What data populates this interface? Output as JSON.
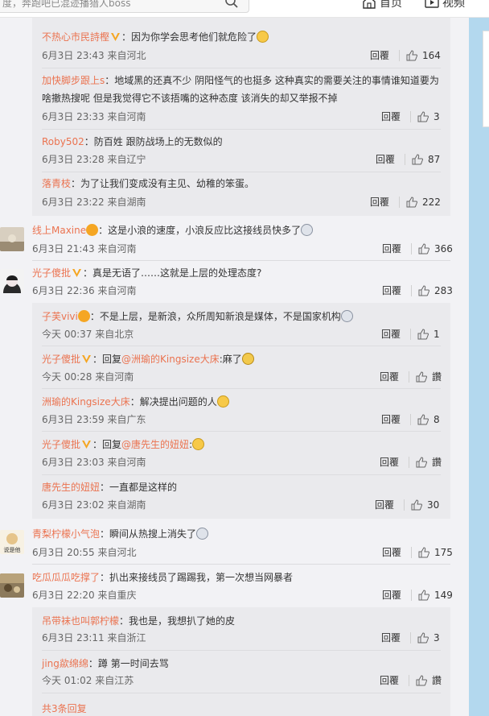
{
  "topbar": {
    "search_text": "度，奔跑吧已混迹播猎人boss",
    "nav_home": "首页",
    "nav_video": "视频"
  },
  "labels": {
    "reply": "回覆",
    "like_zan": "讚"
  },
  "comments": [
    {
      "name": "不热心市民詩樫",
      "badge": "gold-v",
      "text": "因为你学会思考他们就危险了",
      "emoji": "smile-emoji",
      "time": "6月3日 23:43",
      "loc": "来自河北",
      "likes": "164"
    },
    {
      "name": "加快脚步跟上s",
      "badge": "",
      "text": "地域黑的还真不少 阴阳怪气的也挺多 这种真实的需要关注的事情谁知道要为",
      "text2": "啥撤热搜呢 但是我觉得它不该捂嘴的这种态度 该消失的却又举报不掉",
      "time": "6月3日 23:33",
      "loc": "来自河南",
      "likes": "3"
    },
    {
      "name": "Roby502",
      "badge": "",
      "text": "防百姓 跟防战场上的无数似的",
      "time": "6月3日 23:28",
      "loc": "来自辽宁",
      "likes": "87"
    },
    {
      "name": "落青枝",
      "badge": "",
      "text": "为了让我们变成没有主见、幼稚的笨蛋。",
      "time": "6月3日 23:22",
      "loc": "来自湖南",
      "likes": "222"
    },
    {
      "name": "线上Maxine",
      "badge": "orange-crown",
      "text": "这是小浪的速度，小浪反应比这接线员快多了",
      "emoji": "cry-emoji",
      "time": "6月3日 21:43",
      "loc": "来自河南",
      "likes": "366"
    },
    {
      "name": "光子傻批",
      "badge": "gold-v",
      "text": "真是无语了……这就是上层的处理态度?",
      "time": "6月3日 22:36",
      "loc": "来自河南",
      "likes": "283"
    },
    {
      "name": "子芙vivi",
      "badge": "orange-crown",
      "text": "不是上层，是新浪，众所周知新浪是媒体，不是国家机构",
      "emoji": "cry-emoji",
      "time": "今天 00:37",
      "loc": "来自北京",
      "likes": "1"
    },
    {
      "name": "光子傻批",
      "badge": "gold-v",
      "prefix": "回复",
      "mention": "@洲瑜的Kingsize大床",
      "text": ":麻了",
      "emoji": "sweat-emoji",
      "time": "今天 00:28",
      "loc": "来自河南",
      "likes": "讚"
    },
    {
      "name": "洲瑜的Kingsize大床",
      "badge": "",
      "text": "解决提出问题的人",
      "emoji": "shock-emoji",
      "time": "6月3日 23:59",
      "loc": "来自广东",
      "likes": "8"
    },
    {
      "name": "光子傻批",
      "badge": "gold-v",
      "prefix": "回复",
      "mention": "@唐先生的妞妞",
      "text": ":",
      "emoji": "tear-emoji",
      "time": "6月3日 23:03",
      "loc": "来自河南",
      "likes": "讚"
    },
    {
      "name": "唐先生的妞妞",
      "badge": "",
      "text": "一直都是这样的",
      "time": "6月3日 23:02",
      "loc": "来自湖南",
      "likes": "30"
    },
    {
      "name": "青梨柠檬小气泡",
      "badge": "",
      "text": "瞬间从热搜上消失了",
      "emoji": "cry-emoji",
      "time": "6月3日 20:55",
      "loc": "来自河北",
      "likes": "175"
    },
    {
      "name": "吃瓜瓜瓜吃撑了",
      "badge": "",
      "text": "扒出来接线员了踢踢我，第一次想当网暴者",
      "time": "6月3日 22:20",
      "loc": "来自重庆",
      "likes": "149"
    },
    {
      "name": "吊带袜也叫郭柠檬",
      "badge": "",
      "text": "我也是，我想扒了她的皮",
      "time": "6月3日 23:11",
      "loc": "来自浙江",
      "likes": "3"
    },
    {
      "name": "jing歘绵绵",
      "badge": "",
      "text": "蹲 第一时间去骂",
      "time": "今天 01:02",
      "loc": "来自江苏",
      "likes": "讚"
    }
  ],
  "more_replies": "共3条回复",
  "avatars": {
    "maxine": "avatar-maxine",
    "guangzi": "avatar-guangzi",
    "qingli": "avatar-qingli",
    "chigua": "avatar-chigua",
    "qingli_label": "说是他"
  }
}
